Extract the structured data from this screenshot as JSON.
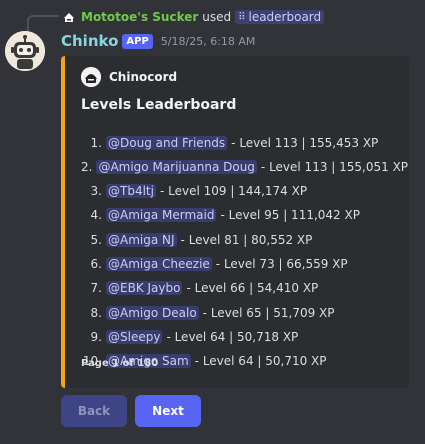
{
  "reply": {
    "username": "Mototoe's Sucker",
    "used_text": "used",
    "command_icon": "slash-command-icon",
    "command": "leaderboard"
  },
  "message": {
    "author": "Chinko",
    "badge": "APP",
    "timestamp": "5/18/25, 6:18 AM"
  },
  "embed": {
    "accent_color": "#f5a31a",
    "author_name": "Chinocord",
    "title": "Levels Leaderboard",
    "entries": [
      {
        "rank": "1.",
        "mention": "@Doug and Friends",
        "stats": "- Level 113 | 155,453 XP"
      },
      {
        "rank": "2.",
        "mention": "@Amigo Marijuanna Doug",
        "stats": "- Level 113 | 155,051 XP"
      },
      {
        "rank": "3.",
        "mention": "@Tb4ltj",
        "stats": "- Level 109 | 144,174 XP"
      },
      {
        "rank": "4.",
        "mention": "@Amiga Mermaid",
        "stats": "- Level 95 | 111,042 XP"
      },
      {
        "rank": "5.",
        "mention": "@Amiga NJ",
        "stats": "- Level 81 | 80,552 XP"
      },
      {
        "rank": "6.",
        "mention": "@Amiga Cheezie",
        "stats": "- Level 73 | 66,559 XP"
      },
      {
        "rank": "7.",
        "mention": "@EBK Jaybo",
        "stats": "- Level 66 | 54,410 XP"
      },
      {
        "rank": "8.",
        "mention": "@Amigo Dealo",
        "stats": "- Level 65 | 51,709 XP"
      },
      {
        "rank": "9.",
        "mention": "@Sleepy",
        "stats": "- Level 64 | 50,718 XP"
      },
      {
        "rank": "10.",
        "mention": "@Amigo Sam",
        "stats": "- Level 64 | 50,710 XP"
      }
    ],
    "footer": "Page 1 of 180"
  },
  "buttons": {
    "back": "Back",
    "next": "Next"
  },
  "colors": {
    "background": "#313338",
    "embed_background": "#2b2d31",
    "blurple": "#5865f2",
    "username_green": "#71c94a",
    "bot_name": "#8ad6e0"
  }
}
